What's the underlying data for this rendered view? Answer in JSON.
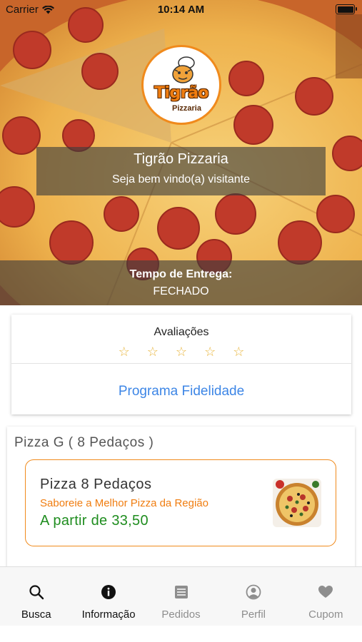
{
  "status_bar": {
    "carrier": "Carrier",
    "time": "10:14 AM"
  },
  "store": {
    "logo_name": "Tigrão",
    "logo_sub": "Pizzaria",
    "name": "Tigrão Pizzaria",
    "welcome": "Seja bem vindo(a) visitante",
    "delivery_label": "Tempo de Entrega:",
    "delivery_value": "FECHADO"
  },
  "ratings": {
    "title": "Avaliações",
    "stars_filled": 0,
    "stars_total": 5,
    "star_color": "#e8b43a",
    "loyalty_link": "Programa Fidelidade"
  },
  "section": {
    "heading": "Pizza G ( 8 Pedaços )",
    "products": [
      {
        "name": "Pizza 8 Pedaços",
        "description": "Saboreie a Melhor Pizza da Região",
        "price": "A partir de 33,50"
      }
    ]
  },
  "tabs": [
    {
      "label": "Busca",
      "icon": "search-icon",
      "active": true
    },
    {
      "label": "Informação",
      "icon": "info-icon",
      "active": true
    },
    {
      "label": "Pedidos",
      "icon": "list-icon",
      "active": false
    },
    {
      "label": "Perfil",
      "icon": "profile-icon",
      "active": false
    },
    {
      "label": "Cupom",
      "icon": "heart-icon",
      "active": false
    }
  ],
  "colors": {
    "accent_orange": "#f08a1c",
    "link_blue": "#3d86e6",
    "price_green": "#1f8d1f"
  }
}
